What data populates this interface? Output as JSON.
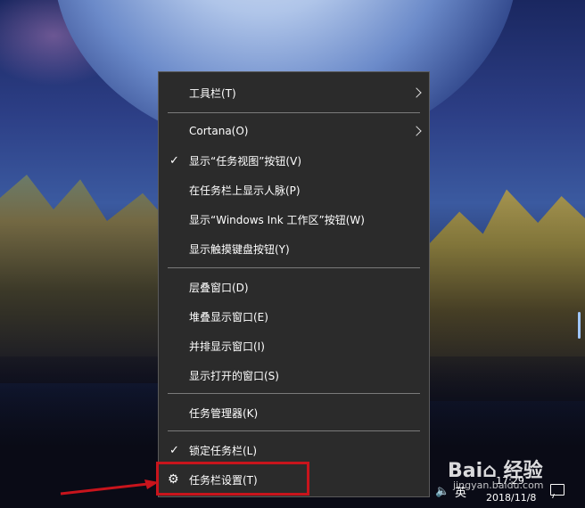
{
  "menu": {
    "items": [
      {
        "label": "工具栏(T)",
        "checked": false,
        "submenu": true
      },
      {
        "label": "Cortana(O)",
        "checked": false,
        "submenu": true
      },
      {
        "label": "显示“任务视图”按钮(V)",
        "checked": true,
        "submenu": false
      },
      {
        "label": "在任务栏上显示人脉(P)",
        "checked": false,
        "submenu": false
      },
      {
        "label": "显示“Windows Ink 工作区”按钮(W)",
        "checked": false,
        "submenu": false
      },
      {
        "label": "显示触摸键盘按钮(Y)",
        "checked": false,
        "submenu": false
      },
      {
        "label": "层叠窗口(D)",
        "checked": false,
        "submenu": false
      },
      {
        "label": "堆叠显示窗口(E)",
        "checked": false,
        "submenu": false
      },
      {
        "label": "并排显示窗口(I)",
        "checked": false,
        "submenu": false
      },
      {
        "label": "显示打开的窗口(S)",
        "checked": false,
        "submenu": false
      },
      {
        "label": "任务管理器(K)",
        "checked": false,
        "submenu": false
      },
      {
        "label": "锁定任务栏(L)",
        "checked": true,
        "submenu": false
      },
      {
        "label": "任务栏设置(T)",
        "checked": false,
        "submenu": false,
        "icon": "gear-icon"
      }
    ],
    "check_glyph": "✓",
    "gear_glyph": "⚙"
  },
  "taskbar": {
    "volume_glyph": "🔈",
    "ime": "英",
    "time": "17:29",
    "date": "2018/11/8"
  },
  "watermark": {
    "brand": "Bai⌂ 经验",
    "site": "jingyan.baidu.com"
  },
  "colors": {
    "menu_bg": "#2b2b2b",
    "highlight": "#c8141c"
  }
}
